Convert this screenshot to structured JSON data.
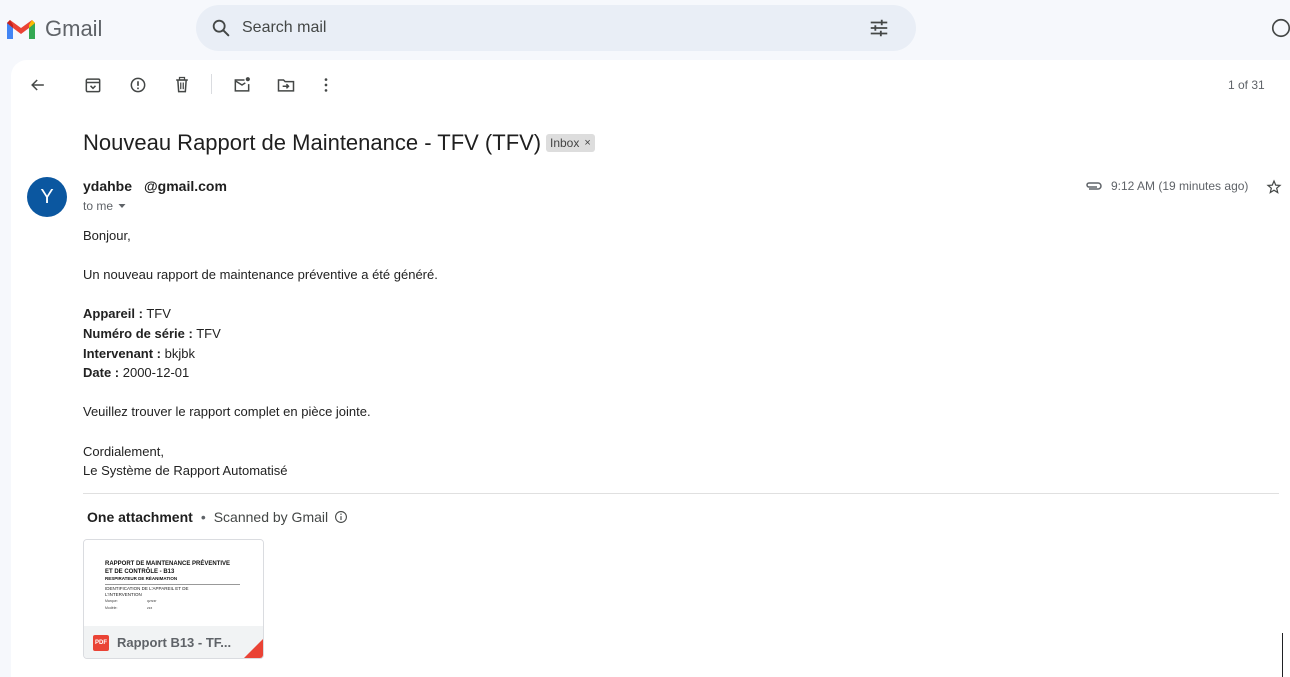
{
  "app": {
    "name": "Gmail"
  },
  "search": {
    "placeholder": "Search mail"
  },
  "toolbar": {
    "counter": "1 of 31"
  },
  "message": {
    "subject": "Nouveau Rapport de Maintenance - TFV (TFV)",
    "label": "Inbox",
    "label_close": "×",
    "avatar_letter": "Y",
    "sender_prefix": "ydahbe",
    "sender_suffix": "@gmail.com",
    "recipient": "to me",
    "time": "9:12 AM (19 minutes ago)",
    "body": {
      "greeting": "Bonjour,",
      "intro": "Un nouveau rapport de maintenance préventive a été généré.",
      "fields": [
        {
          "label": "Appareil :",
          "value": " TFV"
        },
        {
          "label": "Numéro de série :",
          "value": " TFV"
        },
        {
          "label": "Intervenant :",
          "value": " bkjbk"
        },
        {
          "label": "Date :",
          "value": " 2000-12-01"
        }
      ],
      "closing_note": "Veuillez trouver le rapport complet en pièce jointe.",
      "signoff": "Cordialement,",
      "signature": "Le Système de Rapport Automatisé"
    }
  },
  "attachments": {
    "heading": "One attachment",
    "separator": "•",
    "scan_note": "Scanned by Gmail",
    "items": [
      {
        "name": "Rapport B13 - TF...",
        "type_badge": "PDF",
        "preview": {
          "title_line1": "RAPPORT DE MAINTENANCE PRÉVENTIVE",
          "title_line2": "ET DE CONTRÔLE - B13",
          "subtitle": "RESPIRATEUR DE RÉANIMATION",
          "section": "IDENTIFICATION DE L'APPAREIL ET DE",
          "section2": "L'INTERVENTION",
          "row1_label": "Marque:",
          "row1_value": "qzrzzr",
          "row2_label": "Modèle:",
          "row2_value": "zzz"
        }
      }
    ]
  },
  "colors": {
    "avatar_bg": "#0b57a0",
    "pdf_red": "#ea4335",
    "search_bg": "#e9eef6"
  }
}
